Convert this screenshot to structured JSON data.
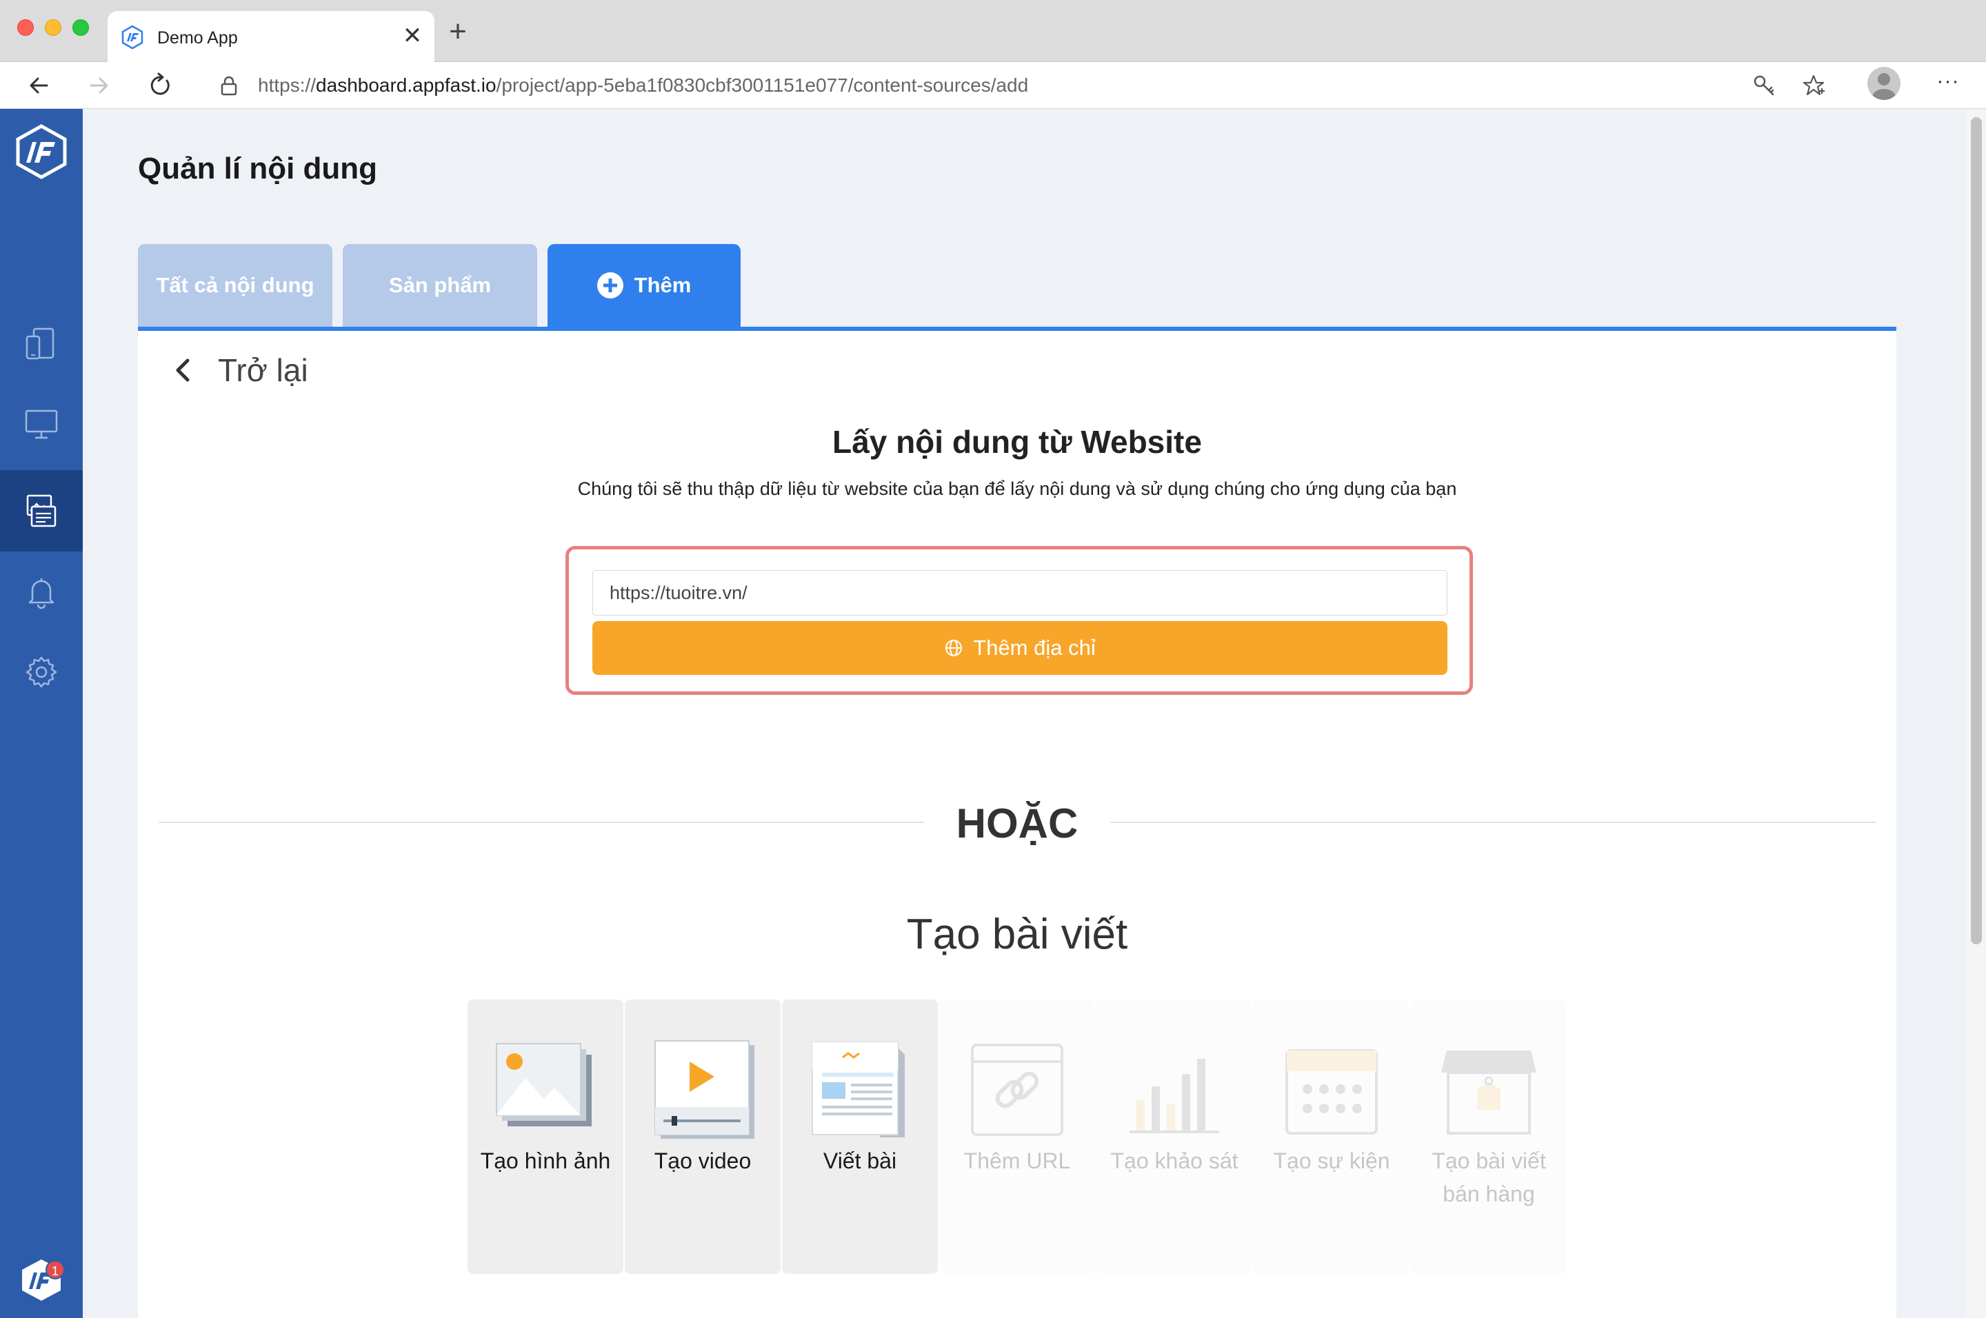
{
  "browser": {
    "tab_title": "Demo App",
    "tab_close": "✕",
    "new_tab": "+",
    "url_prefix": "https://",
    "url_host": "dashboard.appfast.io",
    "url_path": "/project/app-5eba1f0830cbf3001151e077/content-sources/add",
    "menu": "···"
  },
  "sidebar": {
    "items": [
      {
        "icon": "devices-icon",
        "active": false
      },
      {
        "icon": "desktop-icon",
        "active": false
      },
      {
        "icon": "content-icon",
        "active": true
      },
      {
        "icon": "bell-icon",
        "active": false
      },
      {
        "icon": "gear-icon",
        "active": false
      }
    ],
    "notification_count": "1"
  },
  "page": {
    "title": "Quản lí nội dung",
    "tabs": [
      {
        "label": "Tất cả nội dung"
      },
      {
        "label": "Sản phẩm"
      },
      {
        "label": "Thêm"
      }
    ],
    "back_label": "Trở lại"
  },
  "website_source": {
    "title": "Lấy nội dung từ Website",
    "subtitle": "Chúng tôi sẽ thu thập dữ liệu từ website của bạn để lấy nội dung và sử dụng chúng cho ứng dụng của bạn",
    "input_value": "https://tuoitre.vn/",
    "button_label": "Thêm địa chỉ"
  },
  "or_label": "HOẶC",
  "create": {
    "title": "Tạo bài viết",
    "tiles": [
      {
        "label": "Tạo hình ảnh",
        "icon": "image-icon",
        "enabled": true
      },
      {
        "label": "Tạo video",
        "icon": "video-icon",
        "enabled": true
      },
      {
        "label": "Viết bài",
        "icon": "article-icon",
        "enabled": true
      },
      {
        "label": "Thêm URL",
        "icon": "link-icon",
        "enabled": false
      },
      {
        "label": "Tạo khảo sát",
        "icon": "survey-icon",
        "enabled": false
      },
      {
        "label": "Tạo sự kiện",
        "icon": "calendar-icon",
        "enabled": false
      },
      {
        "label": "Tạo bài viết bán hàng",
        "icon": "shop-icon",
        "enabled": false
      }
    ]
  },
  "colors": {
    "sidebar": "#2d5daa",
    "sidebar_active": "#1d4283",
    "accent": "#2f80ed",
    "tab_inactive": "#b5c9e8",
    "button": "#f7a62a",
    "highlight_border": "#e78080"
  }
}
